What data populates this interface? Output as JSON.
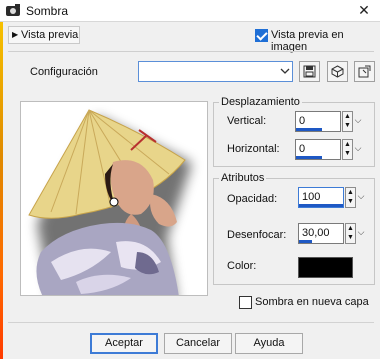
{
  "window": {
    "title": "Sombra"
  },
  "preview": {
    "toggle_label": "Vista previa",
    "image_preview_label": "Vista previa en imagen",
    "image_preview_checked": true
  },
  "config": {
    "label": "Configuración",
    "selected_value": ""
  },
  "offset": {
    "legend": "Desplazamiento",
    "vertical_label": "Vertical:",
    "vertical_value": "0",
    "horizontal_label": "Horizontal:",
    "horizontal_value": "0"
  },
  "attributes": {
    "legend": "Atributos",
    "opacity_label": "Opacidad:",
    "opacity_value": "100",
    "blur_label": "Desenfocar:",
    "blur_value": "30,00",
    "color_label": "Color:",
    "color_value": "#000000"
  },
  "new_layer": {
    "label": "Sombra en nueva capa",
    "checked": false
  },
  "buttons": {
    "ok": "Aceptar",
    "cancel": "Cancelar",
    "help": "Ayuda"
  },
  "accent_color": "#1e58c4"
}
